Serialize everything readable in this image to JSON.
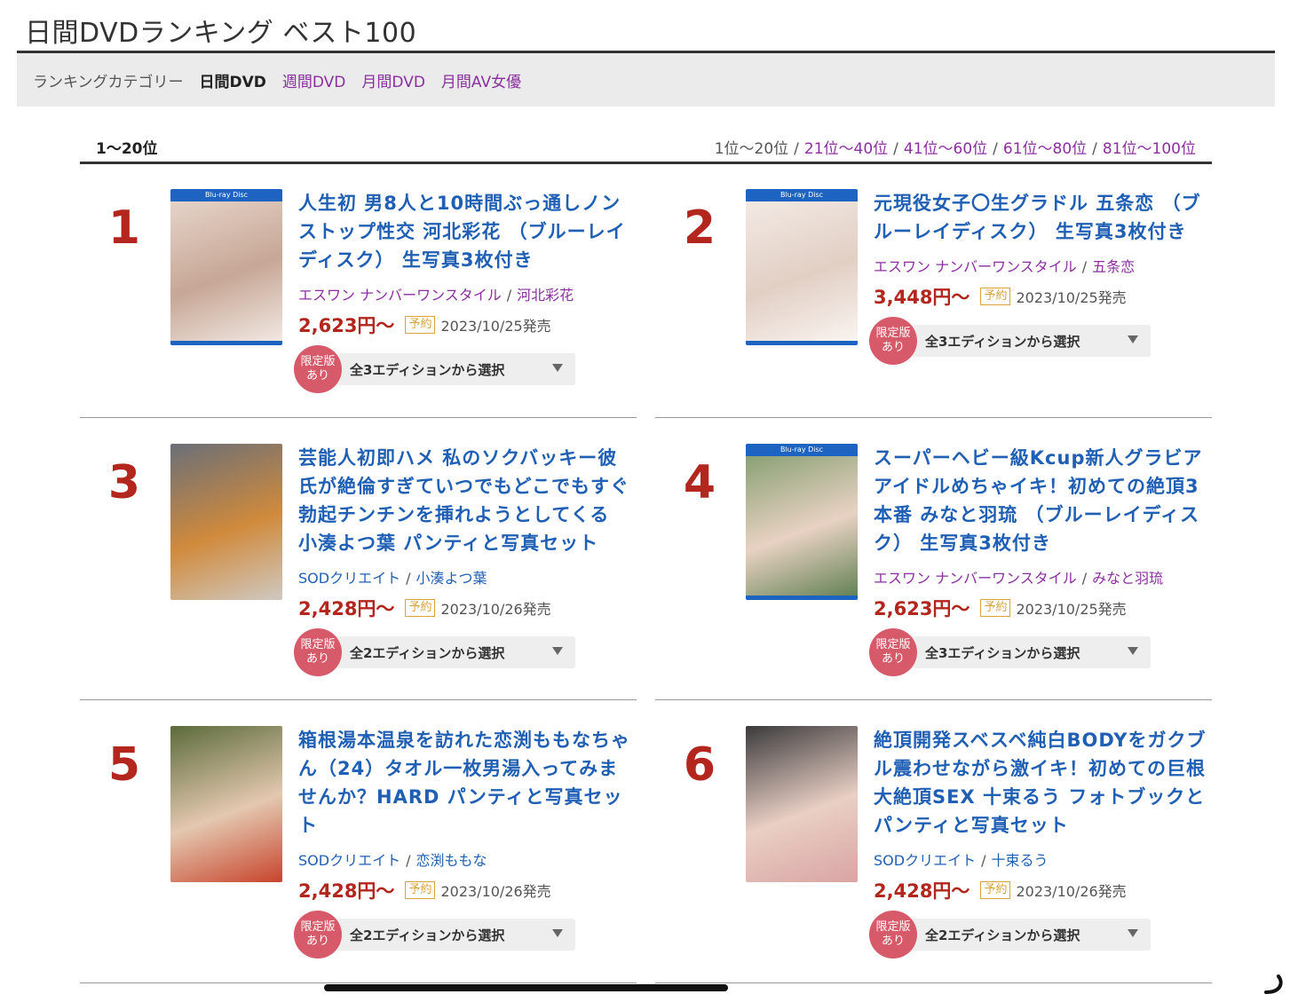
{
  "page": {
    "title": "日間DVDランキング ベスト100"
  },
  "category_bar": {
    "label": "ランキングカテゴリー",
    "current": "日間DVD",
    "links": [
      "週間DVD",
      "月間DVD",
      "月間AV女優"
    ]
  },
  "range": {
    "current": "1〜20位",
    "pager": [
      {
        "label": "1位〜20位",
        "current": true
      },
      {
        "label": "21位〜40位",
        "current": false
      },
      {
        "label": "41位〜60位",
        "current": false
      },
      {
        "label": "61位〜80位",
        "current": false
      },
      {
        "label": "81位〜100位",
        "current": false
      }
    ],
    "separator": "/"
  },
  "colors": {
    "rank": "#b3261e",
    "title_link": "#1f5fb4",
    "maker_link": "#8b2fa0",
    "price": "#b3261e",
    "yoyaku_badge": "#d9a23a",
    "limited_badge": "#d65a6a",
    "bluray_strip": "#1c63c2"
  },
  "items": [
    {
      "rank": "1",
      "title": "人生初 男8人と10時間ぶっ通しノンストップ性交 河北彩花 （ブルーレイディスク） 生写真3枚付き",
      "maker": "エスワン ナンバーワンスタイル",
      "actress": "河北彩花",
      "maker_color": "purple",
      "price": "2,623円〜",
      "badge": "予約",
      "date": "2023/10/25発売",
      "limited": "限定版\nあり",
      "edition": "全3エディションから選択",
      "bluray": true,
      "cover_colors": [
        "#e9d9cf",
        "#c7a796",
        "#f3ebe6"
      ]
    },
    {
      "rank": "2",
      "title": "元現役女子〇生グラドル 五条恋 （ブルーレイディスク） 生写真3枚付き",
      "maker": "エスワン ナンバーワンスタイル",
      "actress": "五条恋",
      "maker_color": "purple",
      "price": "3,448円〜",
      "badge": "予約",
      "date": "2023/10/25発売",
      "limited": "限定版\nあり",
      "edition": "全3エディションから選択",
      "bluray": true,
      "cover_colors": [
        "#f4ede8",
        "#e2cfc4",
        "#faf6f3"
      ]
    },
    {
      "rank": "3",
      "title": "芸能人初即ハメ 私のソクバッキー彼氏が絶倫すぎていつでもどこでもすぐ勃起チンチンを挿れようとしてくる 小湊よつ葉 パンティと写真セット",
      "maker": "SODクリエイト",
      "actress": "小湊よつ葉",
      "maker_color": "blue",
      "price": "2,428円〜",
      "badge": "予約",
      "date": "2023/10/26発売",
      "limited": "限定版\nあり",
      "edition": "全2エディションから選択",
      "bluray": false,
      "cover_colors": [
        "#6a6f78",
        "#d08a3c",
        "#cfc9c2"
      ]
    },
    {
      "rank": "4",
      "title": "スーパーヘビー級Kcup新人グラビアアイドルめちゃイキ！初めての絶頂3本番 みなと羽琉 （ブルーレイディスク） 生写真3枚付き",
      "maker": "エスワン ナンバーワンスタイル",
      "actress": "みなと羽琉",
      "maker_color": "purple",
      "price": "2,623円〜",
      "badge": "予約",
      "date": "2023/10/25発売",
      "limited": "限定版\nあり",
      "edition": "全3エディションから選択",
      "bluray": true,
      "cover_colors": [
        "#7d9a6a",
        "#e8d2c3",
        "#5d7d4f"
      ]
    },
    {
      "rank": "5",
      "title": "箱根湯本温泉を訪れた恋渕ももなちゃん（24）タオル一枚男湯入ってみませんか？HARD パンティと写真セット",
      "maker": "SODクリエイト",
      "actress": "恋渕ももな",
      "maker_color": "blue",
      "price": "2,428円〜",
      "badge": "予約",
      "date": "2023/10/26発売",
      "limited": "限定版\nあり",
      "edition": "全2エディションから選択",
      "bluray": false,
      "cover_colors": [
        "#5b6b3a",
        "#e4c8b0",
        "#c8442c"
      ]
    },
    {
      "rank": "6",
      "title": "絶頂開発スベスベ純白BODYをガクブル震わせながら激イキ！初めての巨根大絶頂SEX 十束るう フォトブックとパンティと写真セット",
      "maker": "SODクリエイト",
      "actress": "十束るう",
      "maker_color": "blue",
      "price": "2,428円〜",
      "badge": "予約",
      "date": "2023/10/26発売",
      "limited": "限定版\nあり",
      "edition": "全2エディションから選択",
      "bluray": false,
      "cover_colors": [
        "#3b3a3c",
        "#e9cfc4",
        "#d9a4a4"
      ]
    }
  ]
}
